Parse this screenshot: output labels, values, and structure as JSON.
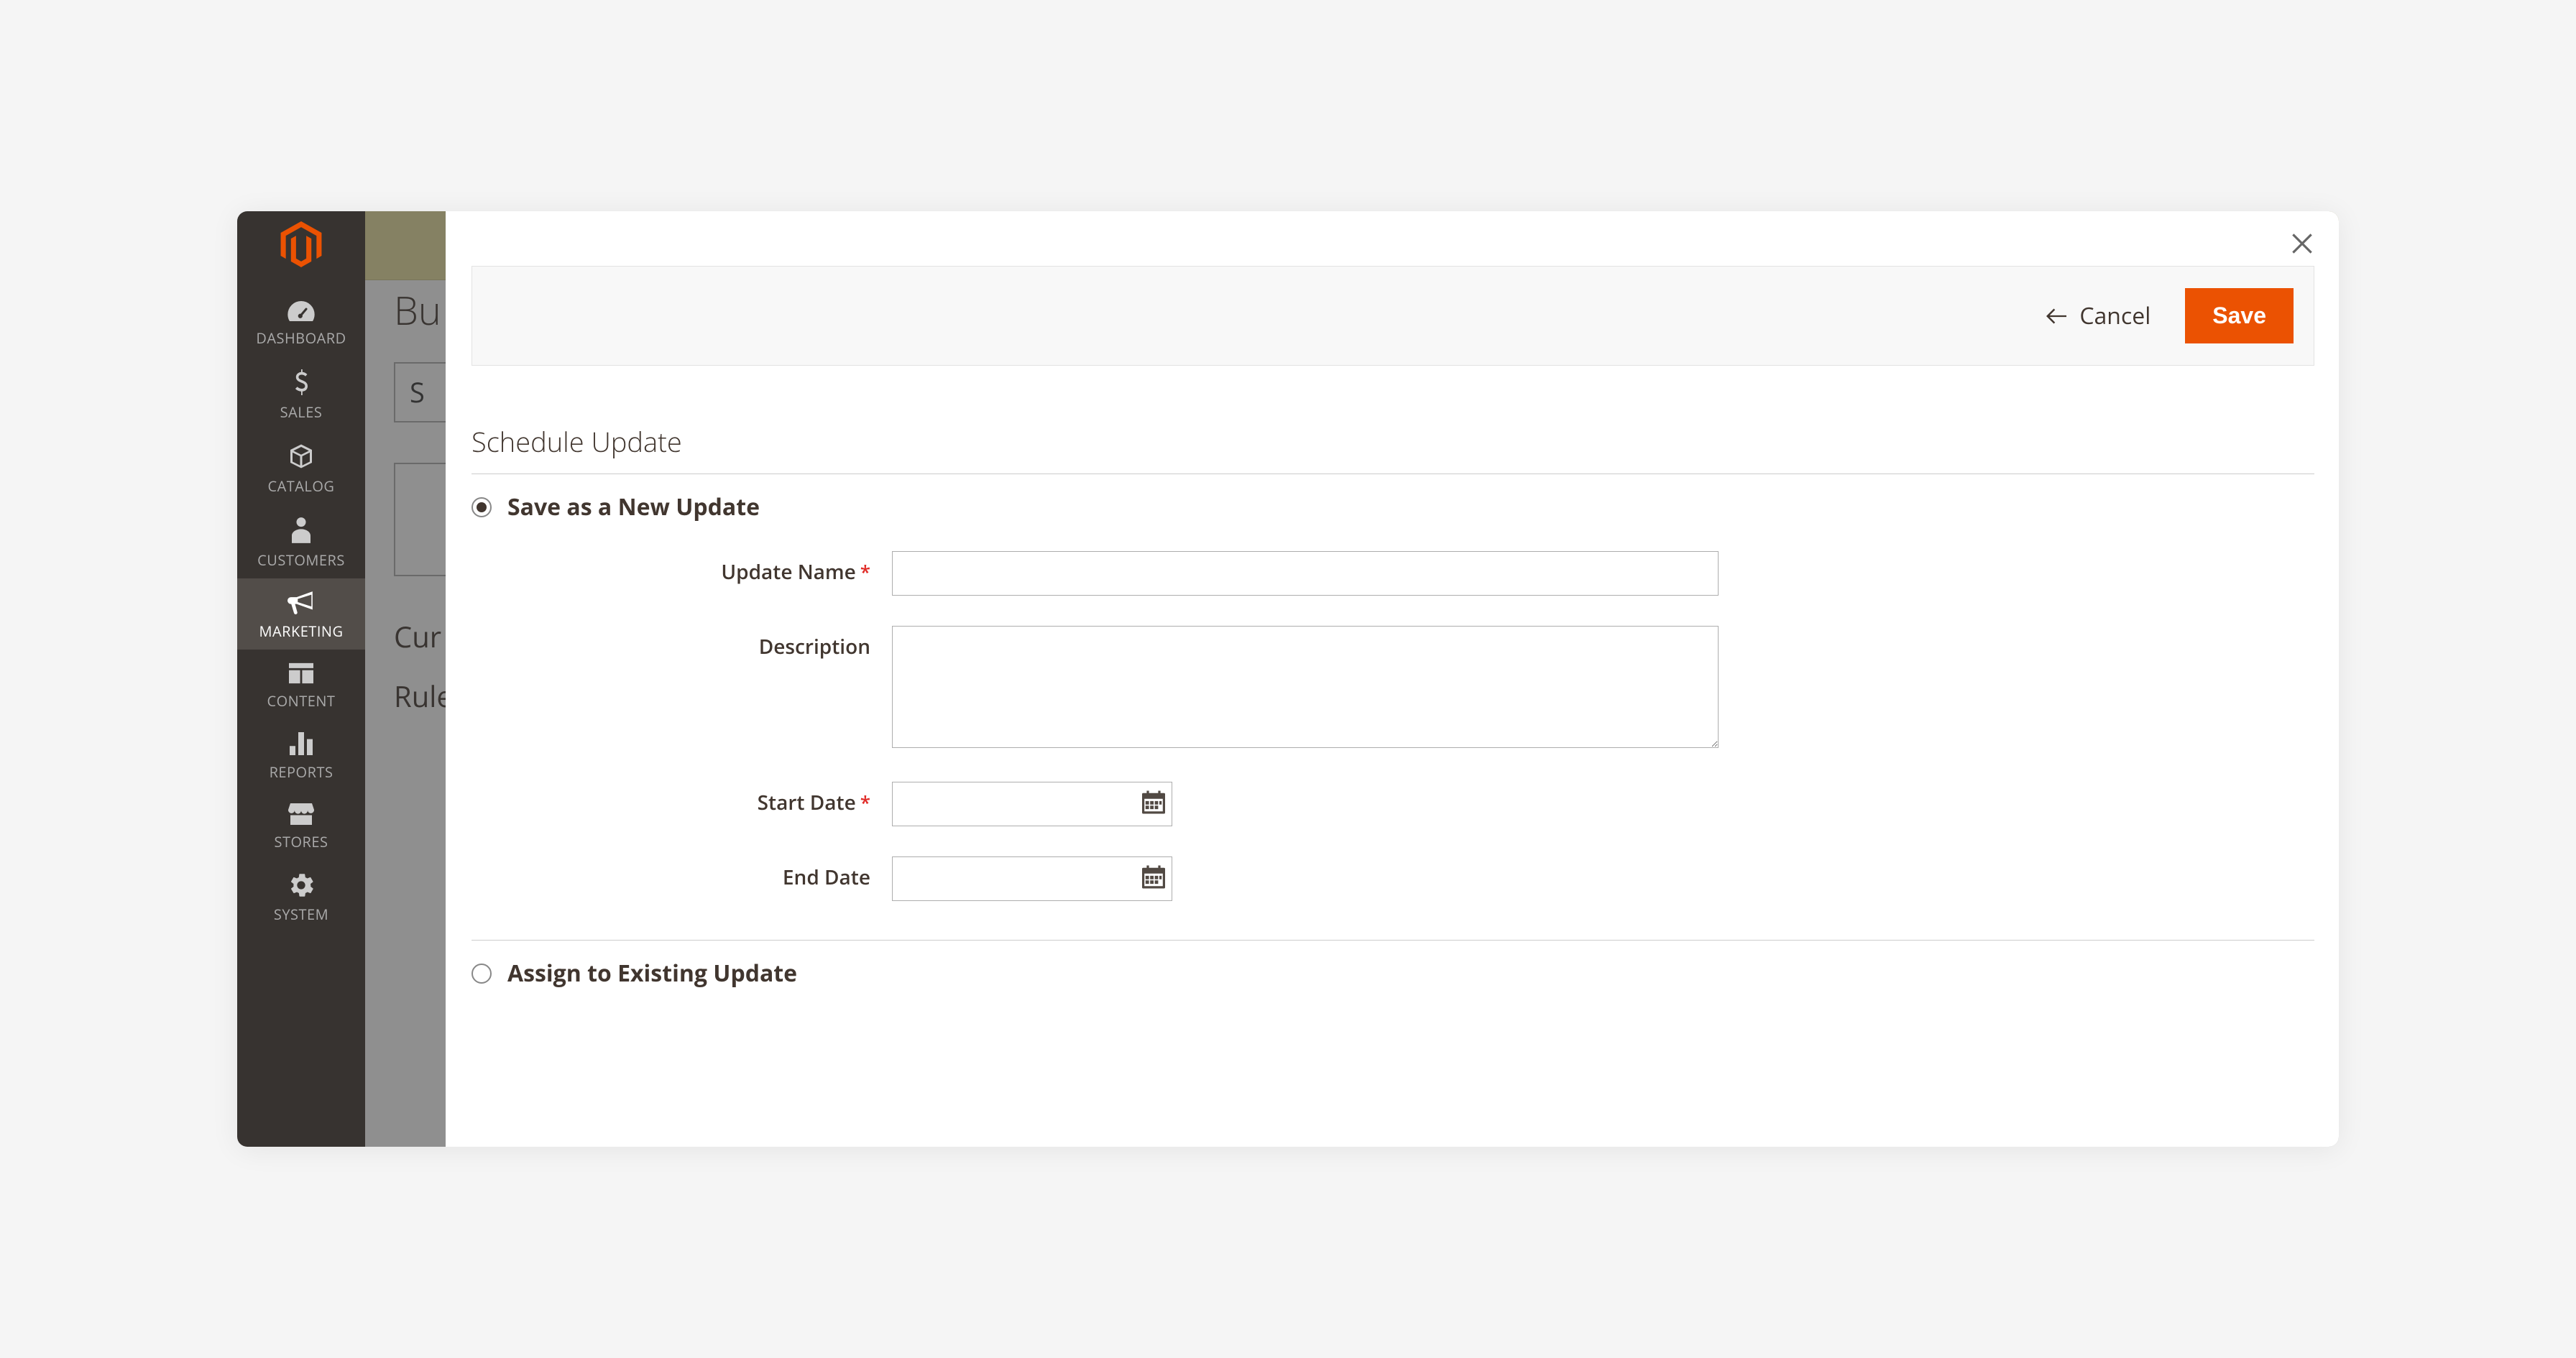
{
  "sidebar": {
    "items": [
      {
        "label": "DASHBOARD"
      },
      {
        "label": "SALES"
      },
      {
        "label": "CATALOG"
      },
      {
        "label": "CUSTOMERS"
      },
      {
        "label": "MARKETING"
      },
      {
        "label": "CONTENT"
      },
      {
        "label": "REPORTS"
      },
      {
        "label": "STORES"
      },
      {
        "label": "SYSTEM"
      }
    ]
  },
  "backdrop": {
    "title_fragment": "Bu",
    "box_char": "S",
    "row1": "Cur",
    "row2": "Rule"
  },
  "modal": {
    "cancel": "Cancel",
    "save": "Save",
    "section_title": "Schedule Update",
    "option_new": "Save as a New Update",
    "option_existing": "Assign to Existing Update",
    "fields": {
      "update_name_label": "Update Name",
      "description_label": "Description",
      "start_date_label": "Start Date",
      "end_date_label": "End Date",
      "update_name_value": "",
      "description_value": "",
      "start_date_value": "",
      "end_date_value": ""
    }
  }
}
